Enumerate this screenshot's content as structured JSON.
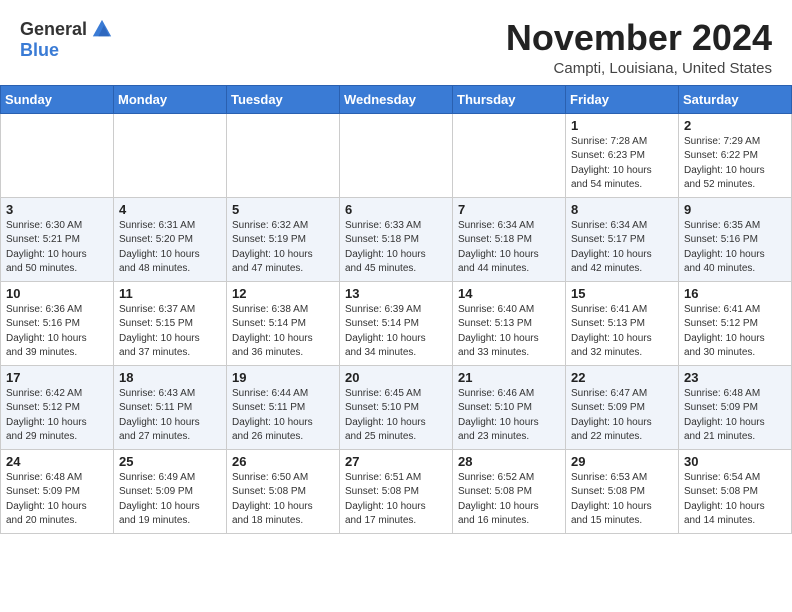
{
  "logo": {
    "general": "General",
    "blue": "Blue"
  },
  "title": "November 2024",
  "subtitle": "Campti, Louisiana, United States",
  "weekdays": [
    "Sunday",
    "Monday",
    "Tuesday",
    "Wednesday",
    "Thursday",
    "Friday",
    "Saturday"
  ],
  "weeks": [
    [
      {
        "day": "",
        "info": ""
      },
      {
        "day": "",
        "info": ""
      },
      {
        "day": "",
        "info": ""
      },
      {
        "day": "",
        "info": ""
      },
      {
        "day": "",
        "info": ""
      },
      {
        "day": "1",
        "info": "Sunrise: 7:28 AM\nSunset: 6:23 PM\nDaylight: 10 hours\nand 54 minutes."
      },
      {
        "day": "2",
        "info": "Sunrise: 7:29 AM\nSunset: 6:22 PM\nDaylight: 10 hours\nand 52 minutes."
      }
    ],
    [
      {
        "day": "3",
        "info": "Sunrise: 6:30 AM\nSunset: 5:21 PM\nDaylight: 10 hours\nand 50 minutes."
      },
      {
        "day": "4",
        "info": "Sunrise: 6:31 AM\nSunset: 5:20 PM\nDaylight: 10 hours\nand 48 minutes."
      },
      {
        "day": "5",
        "info": "Sunrise: 6:32 AM\nSunset: 5:19 PM\nDaylight: 10 hours\nand 47 minutes."
      },
      {
        "day": "6",
        "info": "Sunrise: 6:33 AM\nSunset: 5:18 PM\nDaylight: 10 hours\nand 45 minutes."
      },
      {
        "day": "7",
        "info": "Sunrise: 6:34 AM\nSunset: 5:18 PM\nDaylight: 10 hours\nand 44 minutes."
      },
      {
        "day": "8",
        "info": "Sunrise: 6:34 AM\nSunset: 5:17 PM\nDaylight: 10 hours\nand 42 minutes."
      },
      {
        "day": "9",
        "info": "Sunrise: 6:35 AM\nSunset: 5:16 PM\nDaylight: 10 hours\nand 40 minutes."
      }
    ],
    [
      {
        "day": "10",
        "info": "Sunrise: 6:36 AM\nSunset: 5:16 PM\nDaylight: 10 hours\nand 39 minutes."
      },
      {
        "day": "11",
        "info": "Sunrise: 6:37 AM\nSunset: 5:15 PM\nDaylight: 10 hours\nand 37 minutes."
      },
      {
        "day": "12",
        "info": "Sunrise: 6:38 AM\nSunset: 5:14 PM\nDaylight: 10 hours\nand 36 minutes."
      },
      {
        "day": "13",
        "info": "Sunrise: 6:39 AM\nSunset: 5:14 PM\nDaylight: 10 hours\nand 34 minutes."
      },
      {
        "day": "14",
        "info": "Sunrise: 6:40 AM\nSunset: 5:13 PM\nDaylight: 10 hours\nand 33 minutes."
      },
      {
        "day": "15",
        "info": "Sunrise: 6:41 AM\nSunset: 5:13 PM\nDaylight: 10 hours\nand 32 minutes."
      },
      {
        "day": "16",
        "info": "Sunrise: 6:41 AM\nSunset: 5:12 PM\nDaylight: 10 hours\nand 30 minutes."
      }
    ],
    [
      {
        "day": "17",
        "info": "Sunrise: 6:42 AM\nSunset: 5:12 PM\nDaylight: 10 hours\nand 29 minutes."
      },
      {
        "day": "18",
        "info": "Sunrise: 6:43 AM\nSunset: 5:11 PM\nDaylight: 10 hours\nand 27 minutes."
      },
      {
        "day": "19",
        "info": "Sunrise: 6:44 AM\nSunset: 5:11 PM\nDaylight: 10 hours\nand 26 minutes."
      },
      {
        "day": "20",
        "info": "Sunrise: 6:45 AM\nSunset: 5:10 PM\nDaylight: 10 hours\nand 25 minutes."
      },
      {
        "day": "21",
        "info": "Sunrise: 6:46 AM\nSunset: 5:10 PM\nDaylight: 10 hours\nand 23 minutes."
      },
      {
        "day": "22",
        "info": "Sunrise: 6:47 AM\nSunset: 5:09 PM\nDaylight: 10 hours\nand 22 minutes."
      },
      {
        "day": "23",
        "info": "Sunrise: 6:48 AM\nSunset: 5:09 PM\nDaylight: 10 hours\nand 21 minutes."
      }
    ],
    [
      {
        "day": "24",
        "info": "Sunrise: 6:48 AM\nSunset: 5:09 PM\nDaylight: 10 hours\nand 20 minutes."
      },
      {
        "day": "25",
        "info": "Sunrise: 6:49 AM\nSunset: 5:09 PM\nDaylight: 10 hours\nand 19 minutes."
      },
      {
        "day": "26",
        "info": "Sunrise: 6:50 AM\nSunset: 5:08 PM\nDaylight: 10 hours\nand 18 minutes."
      },
      {
        "day": "27",
        "info": "Sunrise: 6:51 AM\nSunset: 5:08 PM\nDaylight: 10 hours\nand 17 minutes."
      },
      {
        "day": "28",
        "info": "Sunrise: 6:52 AM\nSunset: 5:08 PM\nDaylight: 10 hours\nand 16 minutes."
      },
      {
        "day": "29",
        "info": "Sunrise: 6:53 AM\nSunset: 5:08 PM\nDaylight: 10 hours\nand 15 minutes."
      },
      {
        "day": "30",
        "info": "Sunrise: 6:54 AM\nSunset: 5:08 PM\nDaylight: 10 hours\nand 14 minutes."
      }
    ]
  ]
}
